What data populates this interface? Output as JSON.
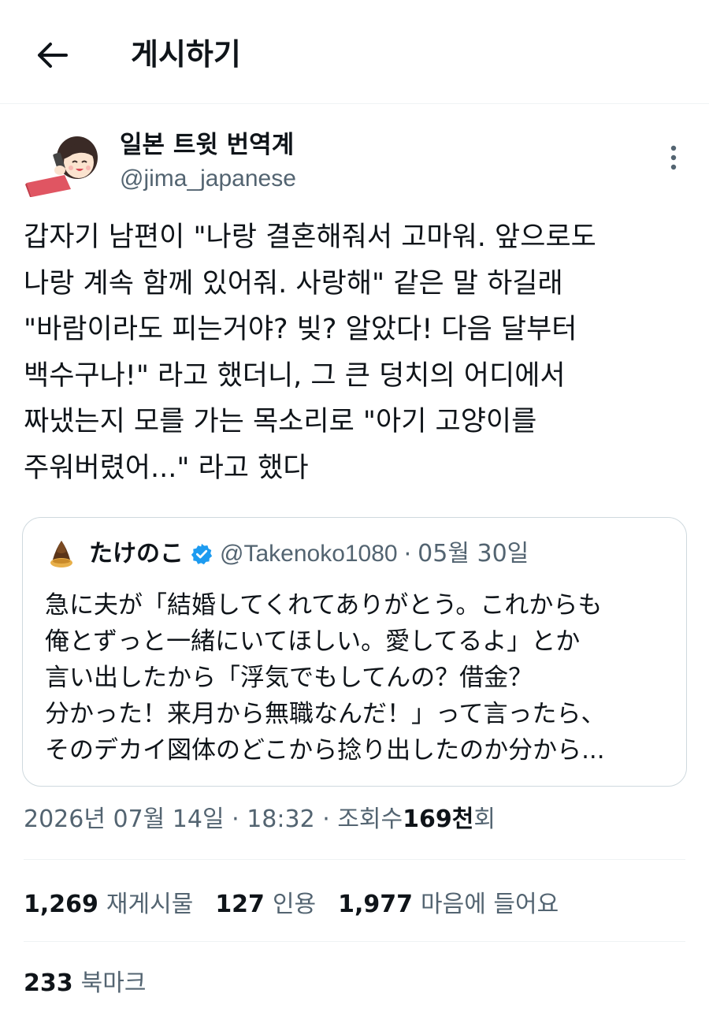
{
  "header": {
    "title": "게시하기",
    "back_icon": "arrow-left-icon"
  },
  "author": {
    "display_name": "일본 트윗 번역계",
    "handle": "@jima_japanese",
    "avatar_icon": "avatar-girl-phone-icon",
    "more_icon": "more-vertical-icon"
  },
  "tweet": {
    "lines": [
      "갑자기 남편이 \"나랑 결혼해줘서 고마워. 앞으로도",
      "나랑 계속 함께 있어줘. 사랑해\" 같은 말 하길래",
      "\"바람이라도 피는거야? 빚? 알았다! 다음 달부터",
      "백수구나!\" 라고 했더니, 그 큰 덩치의 어디에서",
      "짜냈는지 모를 가는 목소리로 \"아기 고양이를",
      "주워버렸어...\" 라고 했다"
    ]
  },
  "quote": {
    "name": "たけのこ",
    "verified_icon": "verified-badge-icon",
    "handle": "@Takenoko1080",
    "separator": "·",
    "date": "05월 30일",
    "lines": [
      "急に夫が「結婚してくれてありがとう。これからも",
      "俺とずっと一緒にいてほしい。愛してるよ」とか",
      "言い出したから「浮気でもしてんの？借金？",
      "分かった！来月から無職なんだ！」って言ったら、",
      "そのデカイ図体のどこから捻り出したのか分から..."
    ]
  },
  "meta": {
    "date": "2026년 07월 14일",
    "sep1": "·",
    "time": "18:32",
    "sep2": "·",
    "views_label": "조회수",
    "views_value": "169천",
    "views_suffix": "회"
  },
  "stats": {
    "reposts": {
      "value": "1,269",
      "label": "재게시물"
    },
    "quotes": {
      "value": "127",
      "label": "인용"
    },
    "likes": {
      "value": "1,977",
      "label": "마음에 들어요"
    },
    "bookmarks": {
      "value": "233",
      "label": "북마크"
    }
  },
  "colors": {
    "text": "#0f1419",
    "secondary": "#536471",
    "border": "#cfd9de",
    "verified": "#1d9bf0"
  }
}
